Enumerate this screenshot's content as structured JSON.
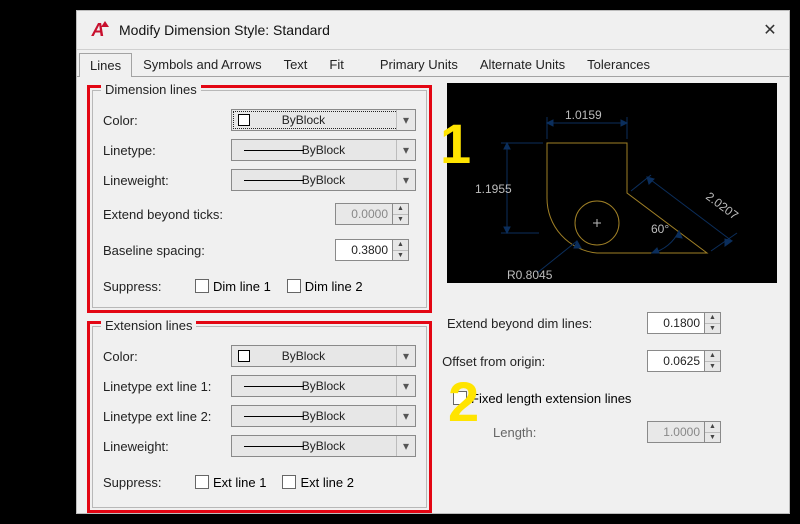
{
  "window": {
    "title": "Modify Dimension Style: Standard"
  },
  "tabs": {
    "lines": "Lines",
    "symbols": "Symbols and Arrows",
    "text": "Text",
    "fit": "Fit",
    "primary": "Primary Units",
    "alternate": "Alternate Units",
    "tolerances": "Tolerances",
    "active": "lines"
  },
  "dimlines": {
    "legend": "Dimension lines",
    "color_label": "Color:",
    "color_value": "ByBlock",
    "linetype_label": "Linetype:",
    "linetype_value": "ByBlock",
    "lineweight_label": "Lineweight:",
    "lineweight_value": "ByBlock",
    "extend_ticks_label": "Extend beyond ticks:",
    "extend_ticks_value": "0.0000",
    "baseline_label": "Baseline spacing:",
    "baseline_value": "0.3800",
    "suppress_label": "Suppress:",
    "dimline1": "Dim line 1",
    "dimline2": "Dim line 2"
  },
  "extlines": {
    "legend": "Extension lines",
    "color_label": "Color:",
    "color_value": "ByBlock",
    "ltype1_label": "Linetype ext line 1:",
    "ltype1_value": "ByBlock",
    "ltype2_label": "Linetype ext line 2:",
    "ltype2_value": "ByBlock",
    "lineweight_label": "Lineweight:",
    "lineweight_value": "ByBlock",
    "suppress_label": "Suppress:",
    "extline1": "Ext line 1",
    "extline2": "Ext line 2"
  },
  "rightopts": {
    "extend_beyond_label": "Extend beyond dim lines:",
    "extend_beyond_value": "0.1800",
    "offset_origin_label": "Offset from origin:",
    "offset_origin_value": "0.0625",
    "fixed_length_label": "Fixed length extension lines",
    "length_label": "Length:",
    "length_value": "1.0000"
  },
  "markers": {
    "one": "1",
    "two": "2"
  },
  "preview": {
    "dim_top": "1.0159",
    "dim_left": "1.1955",
    "dim_diag": "2.0207",
    "dim_angle": "60°",
    "dim_radius": "R0.8045"
  }
}
